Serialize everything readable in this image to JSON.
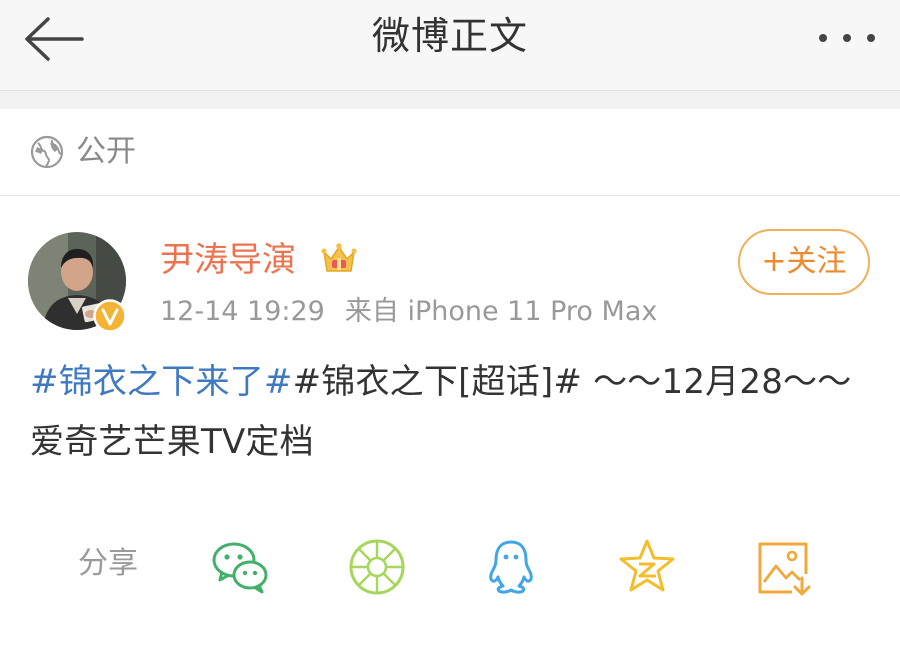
{
  "header": {
    "title": "微博正文",
    "back_icon": "back-arrow-icon",
    "more_icon": "more-dots-icon"
  },
  "visibility": {
    "icon": "globe-icon",
    "label": "公开"
  },
  "post": {
    "author": {
      "name": "尹涛导演",
      "badge_icon": "crown-icon",
      "verified_icon": "verified-badge-icon"
    },
    "time": "12-14 19:29",
    "source": "来自 iPhone 11 Pro Max",
    "follow_label": "+关注",
    "content": {
      "topic1": "#锦衣之下来了#",
      "topic2": "#锦衣之下[超话]#",
      "line1_rest": " ～～12月28～～",
      "line2": "爱奇艺芒果TV定档"
    }
  },
  "share": {
    "label": "分享",
    "targets": [
      "wechat-icon",
      "moments-icon",
      "qq-icon",
      "qzone-icon",
      "save-image-icon"
    ]
  },
  "colors": {
    "accent_orange": "#eb7350",
    "topic_blue": "#3e79c2",
    "follow_border": "#f1b05a"
  }
}
